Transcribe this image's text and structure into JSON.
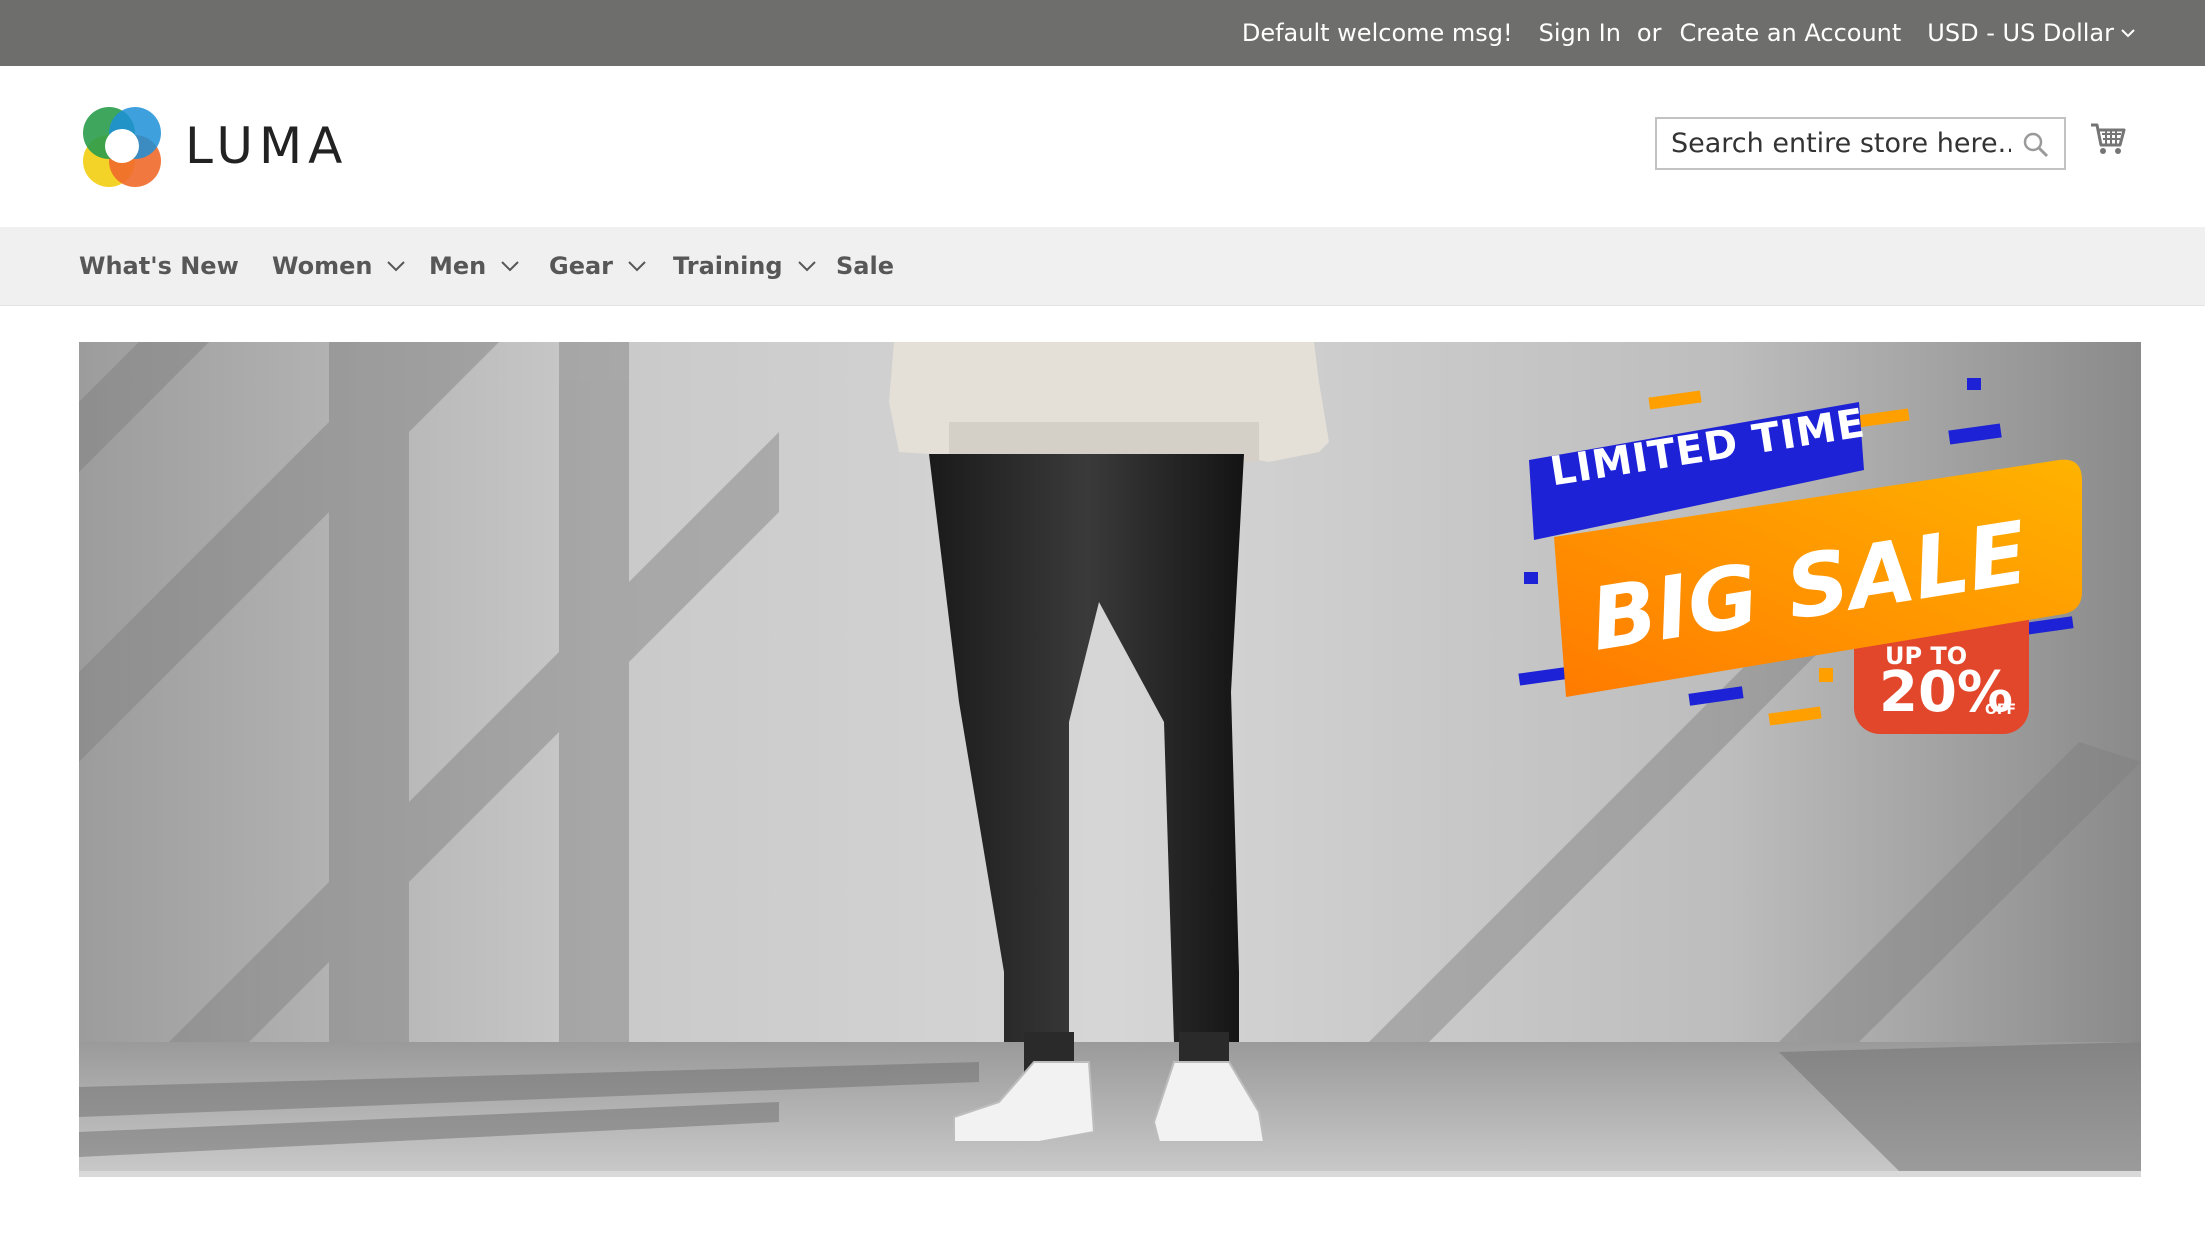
{
  "topbar": {
    "welcome": "Default welcome msg!",
    "sign_in": "Sign In",
    "or": "or",
    "create_account": "Create an Account",
    "currency": "USD - US Dollar"
  },
  "header": {
    "logo_text": "LUMA",
    "search": {
      "placeholder": "Search entire store here..."
    },
    "icons": {
      "search": "search-icon",
      "cart": "cart-icon"
    }
  },
  "nav": {
    "items": [
      {
        "label": "What's New",
        "has_dropdown": false
      },
      {
        "label": "Women",
        "has_dropdown": true
      },
      {
        "label": "Men",
        "has_dropdown": true
      },
      {
        "label": "Gear",
        "has_dropdown": true
      },
      {
        "label": "Training",
        "has_dropdown": true
      },
      {
        "label": "Sale",
        "has_dropdown": false
      }
    ]
  },
  "hero": {
    "banner": {
      "line1": "LIMITED TIME",
      "line2": "BIG SALE",
      "badge_top": "UP TO",
      "badge_value": "20%",
      "badge_off": "OFF"
    }
  },
  "colors": {
    "topbar_bg": "#6e6e6c",
    "nav_bg": "#f0f0f0",
    "banner_blue": "#1d22d6",
    "banner_orange": "#ff9f00",
    "badge_red": "#e2472c"
  }
}
